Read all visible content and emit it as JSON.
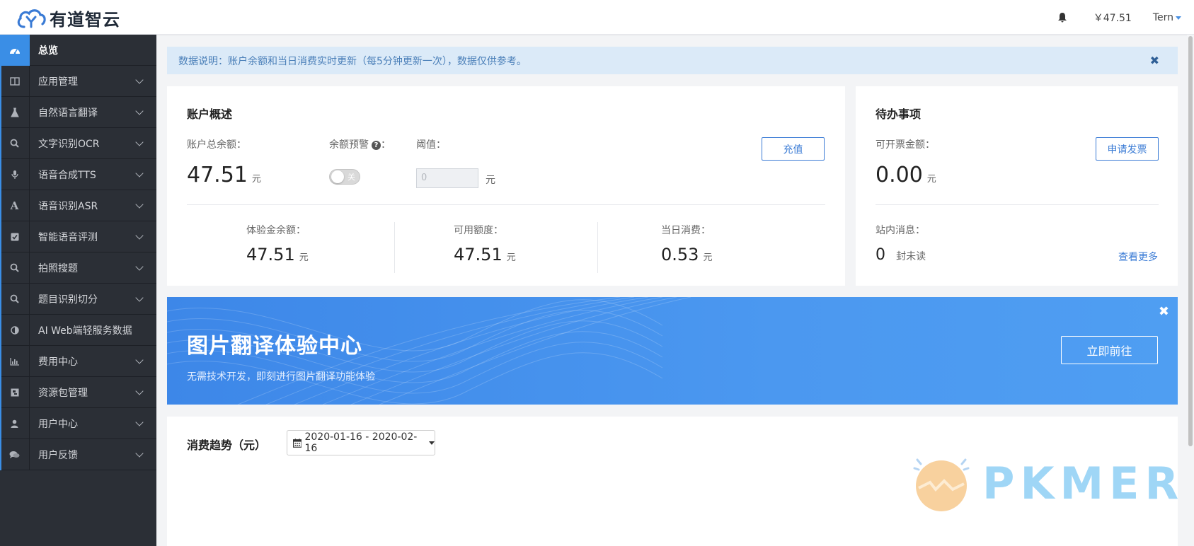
{
  "header": {
    "logo_text": "有道智云",
    "balance": "￥47.51",
    "user": "Tern"
  },
  "sidebar": {
    "items": [
      {
        "label": "总览",
        "icon": "dashboard-icon"
      },
      {
        "label": "应用管理",
        "icon": "columns-icon"
      },
      {
        "label": "自然语言翻译",
        "icon": "flask-icon"
      },
      {
        "label": "文字识别OCR",
        "icon": "search-icon"
      },
      {
        "label": "语音合成TTS",
        "icon": "microphone-icon"
      },
      {
        "label": "语音识别ASR",
        "icon": "font-icon"
      },
      {
        "label": "智能语音评测",
        "icon": "check-square-icon"
      },
      {
        "label": "拍照搜题",
        "icon": "search-icon"
      },
      {
        "label": "题目识别切分",
        "icon": "search-icon"
      },
      {
        "label": "AI Web端轻服务数据",
        "icon": "adjust-icon"
      },
      {
        "label": "费用中心",
        "icon": "bar-chart-icon"
      },
      {
        "label": "资源包管理",
        "icon": "package-icon"
      },
      {
        "label": "用户中心",
        "icon": "user-icon"
      },
      {
        "label": "用户反馈",
        "icon": "comments-icon"
      }
    ]
  },
  "notice": {
    "text": "数据说明：账户余额和当日消费实时更新（每5分钟更新一次），数据仅供参考。",
    "close": "✖"
  },
  "account": {
    "title": "账户概述",
    "total_label": "账户总余额：",
    "total_value": "47.51",
    "unit": "元",
    "alert_label": "余额预警",
    "alert_colon": "：",
    "alert_toggle": "关",
    "threshold_label": "阈值：",
    "threshold_placeholder": "0",
    "threshold_unit": "元",
    "recharge_button": "充值",
    "trial_label": "体验金余额：",
    "trial_value": "47.51",
    "available_label": "可用额度：",
    "available_value": "47.51",
    "today_label": "当日消费：",
    "today_value": "0.53"
  },
  "todo": {
    "title": "待办事项",
    "invoice_label": "可开票金额：",
    "invoice_value": "0.00",
    "unit": "元",
    "invoice_button": "申请发票",
    "messages_label": "站内消息：",
    "messages_count": "0",
    "messages_suffix": "封未读",
    "more_link": "查看更多"
  },
  "banner": {
    "title": "图片翻译体验中心",
    "subtitle": "无需技术开发，即刻进行图片翻译功能体验",
    "button": "立即前往",
    "close": "✖"
  },
  "trend": {
    "title": "消费趋势（元）",
    "date_range": "2020-01-16 - 2020-02-16"
  },
  "watermark": {
    "text": "PKMER"
  },
  "colors": {
    "accent": "#3a8ee6",
    "sidebar_bg": "#2b2f36",
    "notice_bg": "#dbeaf8",
    "banner_bg": "#4b98f0"
  }
}
